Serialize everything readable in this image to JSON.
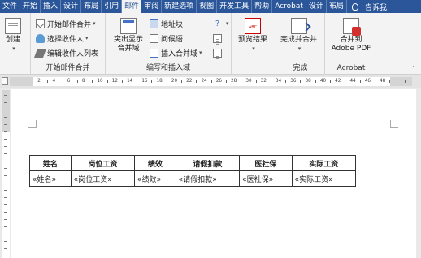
{
  "ribbon_tabs": [
    "文件",
    "开始",
    "插入",
    "设计",
    "布局",
    "引用",
    "邮件",
    "审阅",
    "新建选项",
    "视图",
    "开发工具",
    "帮助",
    "Acrobat",
    "设计",
    "布局"
  ],
  "active_tab_index": 6,
  "tell_me": "告诉我",
  "groups": {
    "create": {
      "label": "创建"
    },
    "start_merge": {
      "label": "开始邮件合并",
      "start_merge": "开始邮件合并",
      "select_recipients": "选择收件人",
      "edit_list": "编辑收件人列表"
    },
    "write_insert": {
      "label": "编写和插入域",
      "highlight_fields": "突出显示\n合并域",
      "address_block": "地址块",
      "greeting_line": "问候语",
      "insert_field": "插入合并域"
    },
    "preview": {
      "label": "预览结果"
    },
    "finish": {
      "label": "完成",
      "finish_merge": "完成并合并"
    },
    "acrobat": {
      "label": "Acrobat",
      "combine_pdf": "合并到\nAdobe PDF"
    }
  },
  "ruler": {
    "h_numbers": [
      "2",
      "4",
      "6",
      "8",
      "10",
      "12",
      "14",
      "16",
      "18",
      "20",
      "22",
      "24",
      "26",
      "28",
      "30",
      "32",
      "34",
      "36",
      "38",
      "40",
      "42",
      "44",
      "46",
      "48"
    ],
    "v_numbers": [
      "2",
      "1",
      "1",
      "2",
      "3",
      "4"
    ]
  },
  "table": {
    "headers": [
      "姓名",
      "岗位工资",
      "绩效",
      "请假扣款",
      "医社保",
      "实际工资"
    ],
    "row": [
      "«姓名»",
      "«岗位工资»",
      "«绩效»",
      "«请假扣款»",
      "«医社保»",
      "«实际工资»"
    ]
  },
  "colors": {
    "ribbon_blue": "#2b579a",
    "ribbon_bg": "#f3f3f3"
  }
}
